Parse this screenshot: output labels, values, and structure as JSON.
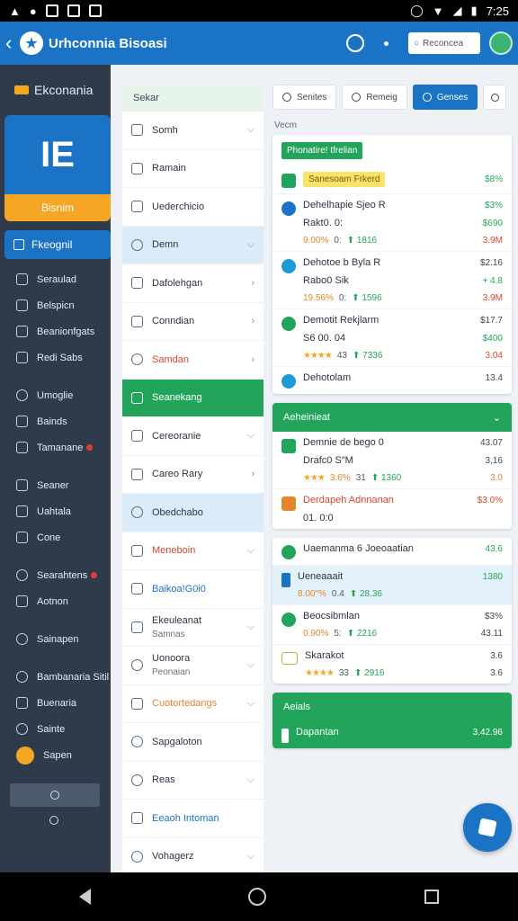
{
  "status_bar": {
    "time": "7:25"
  },
  "app_bar": {
    "title": "Urhconnia Bisoasi",
    "search_placeholder": "Reconcea",
    "logo_glyph": "★"
  },
  "sidebar": {
    "header": "Ekconania",
    "hero_glyph": "IE",
    "hero_label": "Bisnim",
    "active_item": "Fkeognil",
    "items": [
      {
        "label": "Seraulad",
        "icon": "square"
      },
      {
        "label": "Belspicn",
        "icon": "pencil"
      },
      {
        "label": "Beanionfgats",
        "icon": "square"
      },
      {
        "label": "Redi Sabs",
        "icon": "square"
      },
      {
        "gap": true
      },
      {
        "label": "Umoglie",
        "icon": "round"
      },
      {
        "label": "Bainds",
        "icon": "square"
      },
      {
        "label": "Tamanane",
        "icon": "square",
        "badge": true
      },
      {
        "gap": true
      },
      {
        "label": "Seaner",
        "icon": "square"
      },
      {
        "label": "Uahtala",
        "icon": "pencil"
      },
      {
        "label": "Cone",
        "icon": "square"
      },
      {
        "gap": true
      },
      {
        "label": "Searahtens",
        "icon": "round",
        "badge": true
      },
      {
        "label": "Aotnon",
        "icon": "square"
      },
      {
        "gap": true
      },
      {
        "label": "Sainapen",
        "icon": "round"
      },
      {
        "gap": true
      },
      {
        "label": "Bambanaria Sitil",
        "icon": "round"
      },
      {
        "label": "Buenaria",
        "icon": "square"
      },
      {
        "label": "Sainte",
        "icon": "round"
      }
    ],
    "profile_label": "Sapen"
  },
  "mid": {
    "header": "Sekar",
    "items": [
      {
        "label": "Somh",
        "icon": "square",
        "chev": "⌵",
        "style": ""
      },
      {
        "label": "Ramain",
        "icon": "square",
        "chev": "",
        "style": ""
      },
      {
        "label": "Uederchicio",
        "icon": "square",
        "chev": "",
        "style": ""
      },
      {
        "label": "Demn",
        "icon": "round",
        "chev": "⌵",
        "style": "blue-bg"
      },
      {
        "label": "Dafolehgan",
        "icon": "square",
        "chev": "›",
        "style": ""
      },
      {
        "label": "Conndian",
        "icon": "square",
        "chev": "›",
        "style": ""
      },
      {
        "label": "Samdan",
        "icon": "round",
        "chev": "›",
        "style": "red"
      },
      {
        "label": "Seanekang",
        "icon": "square",
        "chev": "",
        "style": "green"
      },
      {
        "label": "Cereoranie",
        "icon": "square",
        "chev": "⌵",
        "style": ""
      },
      {
        "label": "Careo Rary",
        "icon": "square",
        "chev": "›",
        "style": ""
      },
      {
        "label": "Obedchabo",
        "icon": "round",
        "chev": "",
        "style": "blue-bg"
      },
      {
        "label": "Meneboin",
        "icon": "square",
        "chev": "⌵",
        "style": "red"
      },
      {
        "label": "Baikoa!G0i0",
        "icon": "square",
        "chev": "",
        "style": "blue"
      },
      {
        "label": "Ekeuleanat",
        "sub": "Samnas",
        "icon": "square",
        "chev": "⌵",
        "style": ""
      },
      {
        "label": "Uonoora",
        "sub": "Peonaian",
        "icon": "round",
        "chev": "⌵",
        "style": ""
      },
      {
        "label": "Cuotortedangs",
        "icon": "square",
        "chev": "⌵",
        "style": "orange"
      },
      {
        "label": "Sapgaloton",
        "icon": "round",
        "chev": "",
        "style": ""
      },
      {
        "label": "Reas",
        "icon": "round",
        "chev": "⌵",
        "style": ""
      },
      {
        "label": "Eeaoh Intoman",
        "icon": "square",
        "chev": "",
        "style": "blue"
      },
      {
        "label": "Vohagerz",
        "icon": "round",
        "chev": "⌵",
        "style": ""
      }
    ]
  },
  "tabs": [
    {
      "label": "Senites",
      "active": false
    },
    {
      "label": "Remeig",
      "active": false
    },
    {
      "label": "Genses",
      "active": true
    }
  ],
  "section_label": "Vecm",
  "card1": {
    "tag": "Phonatire! tfrelian",
    "highlight": {
      "text": "Sanesoam Frkerd",
      "value": "$8%"
    },
    "rows": [
      {
        "icon": "b",
        "name": "Dehelhapie Sjeo R",
        "val1": "$3%",
        "val1c": "g",
        "line2": "Rakt0. 0:",
        "val2": "$690",
        "val2c": "g",
        "pct": "9.00%",
        "pctc": "",
        "dot": "0:",
        "up": "⬆ 1816",
        "val3": "3.9M",
        "val3c": "r"
      },
      {
        "icon": "t",
        "name": "Dehotoe b Byla R",
        "val1": "$2.16",
        "val1c": "",
        "line2": "Rabo0 Sik",
        "val2": "+ 4.8",
        "val2c": "g",
        "pct": "19.56%",
        "pctc": "",
        "dot": "0:",
        "up": "⬆ 1596",
        "val3": "3.9M",
        "val3c": "r"
      },
      {
        "icon": "g",
        "name": "Demotit Rekjlarm",
        "val1": "$17.7",
        "val1c": "",
        "line2": "S6 00. 04",
        "val2": "$400",
        "val2c": "g",
        "pct": "",
        "stars": "★★★★",
        "dot": "43",
        "up": "⬆ 7336",
        "val3": "3.04",
        "val3c": "r"
      },
      {
        "icon": "t",
        "name": "Dehotolam",
        "val1": "13.4",
        "val1c": "",
        "line2": "",
        "val2": "",
        "val2c": "",
        "pct": "",
        "dot": "",
        "up": "",
        "val3": "",
        "val3c": ""
      }
    ]
  },
  "card2": {
    "header": "Aeheinieat",
    "rows": [
      {
        "icon": "sq-g",
        "name": "Demnie de bego 0",
        "nameStyle": "",
        "val1": "43.07",
        "val1c": "",
        "line2": "Drafc0 S″M",
        "val2": "3,16",
        "val2c": "",
        "pct": "3.6%",
        "pctc": "",
        "stars": "★★★",
        "dot": "31",
        "up": "⬆ 1360",
        "val3": "3.0",
        "val3c": "o"
      },
      {
        "icon": "sq-o",
        "name": "Derdapeh Adnnanan",
        "nameStyle": "red",
        "val1": "$3.0%",
        "val1c": "r",
        "line2": "01. 0:0",
        "val2": "",
        "val2c": "",
        "pct": "",
        "dot": "",
        "up": "",
        "val3": "",
        "val3c": ""
      }
    ]
  },
  "card3": {
    "rows": [
      {
        "icon": "g",
        "name": "Uaemanma 6 Joeoaatian",
        "nameStyle": "",
        "nameBlue": "Joeoaatian",
        "val1": "43.6",
        "val1c": "g",
        "line2": "",
        "val2": "",
        "val2c": "",
        "pct": "",
        "dot": "",
        "up": "",
        "val3": "",
        "val3c": "",
        "bg": ""
      },
      {
        "icon": "sq-b",
        "name": "Ueneaaait",
        "nameStyle": "",
        "val1": "1380",
        "val1c": "g",
        "line2": "",
        "val2": "",
        "val2c": "",
        "pct": "8.00″%",
        "pctc": "",
        "dot": "0.4",
        "up": "⬆ 28.36",
        "val3": "",
        "val3c": "",
        "bg": "blue-bg"
      },
      {
        "icon": "g",
        "name": "Beocsibmlan",
        "nameStyle": "",
        "val1": "$3%",
        "val1c": "",
        "line2": "",
        "val2": "",
        "val2c": "",
        "pct": "0.90%",
        "pctc": "",
        "dot": "5:",
        "up": "⬆ 2216",
        "val3": "43.11",
        "val3c": "",
        "bg": ""
      },
      {
        "icon": "yellow-sq",
        "name": "Skarakot",
        "nameStyle": "",
        "val1": "3.6",
        "val1c": "",
        "line2": "",
        "val2": "",
        "val2c": "",
        "pct": "",
        "stars": "★★★★",
        "dot": "33",
        "up": "⬆ 2916",
        "val3": "3.6",
        "val3c": "",
        "bg": ""
      }
    ]
  },
  "card4": {
    "header": "Aeials",
    "footer_label": "Dapantan",
    "footer_val": "3.42.96"
  }
}
